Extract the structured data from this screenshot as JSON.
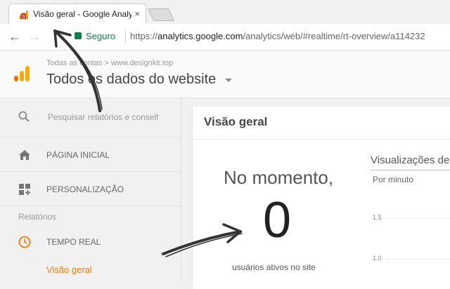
{
  "browser": {
    "tab_title": "Visão geral - Google Analytics",
    "security_label": "Seguro",
    "url_scheme": "https://",
    "url_host": "analytics.google.com",
    "url_path": "/analytics/web/#realtime/rt-overview/a114232"
  },
  "header": {
    "breadcrumb": "Todas as contas > www.designkit.top",
    "property_name": "Todos os dados do website"
  },
  "sidebar": {
    "search_placeholder": "Pesquisar relatórios e conselhos",
    "items": [
      {
        "label": "PÁGINA INICIAL",
        "icon": "home-icon"
      },
      {
        "label": "PERSONALIZAÇÃO",
        "icon": "customization-icon"
      }
    ],
    "section_label": "Relatórios",
    "realtime_label": "TEMPO REAL",
    "realtime_sub_label": "Visão geral"
  },
  "main": {
    "title": "Visão geral",
    "now_label": "No momento,",
    "active_users": "0",
    "active_users_label": "usuários ativos no site",
    "chart_title": "Visualizações de",
    "chart_subtitle": "Por minuto",
    "y_ticks": [
      "1.5",
      "1.0"
    ]
  },
  "colors": {
    "accent_orange": "#f57c00",
    "secure_green": "#0b8043"
  }
}
